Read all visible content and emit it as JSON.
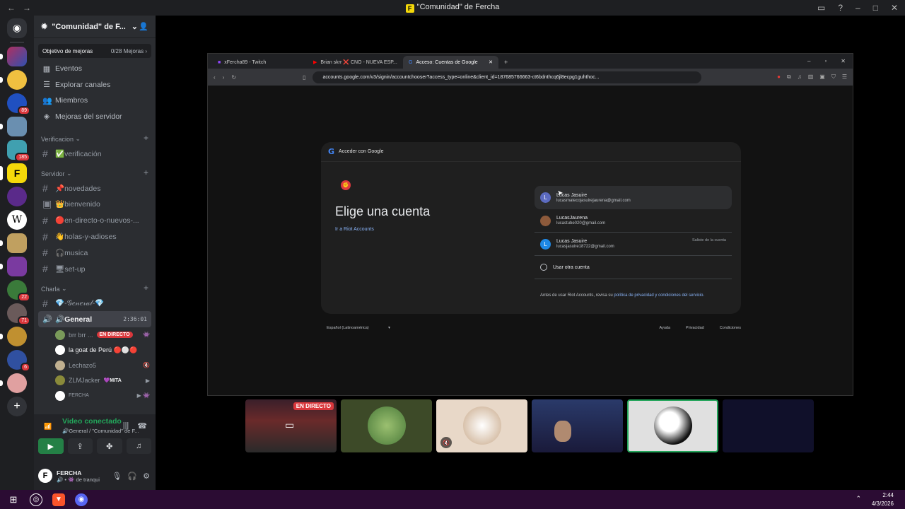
{
  "window": {
    "title": "\"Comunidad\" de Fercha"
  },
  "server": {
    "name": "\"Comunidad\" de F...",
    "boost_label": "Objetivo de mejoras",
    "boost_count": "0/28 Mejoras"
  },
  "guild_badges": {
    "marvel": "89",
    "g5": "185",
    "g13": "22",
    "g14": "71",
    "g16": "6"
  },
  "nav": [
    "Eventos",
    "Explorar canales",
    "Miembros",
    "Mejoras del servidor"
  ],
  "categories": {
    "verificacion": "Verificacion",
    "servidor": "Servidor",
    "charla": "Charla"
  },
  "channels": {
    "verificacion": "✅verificación",
    "servidor": [
      "📌novedades",
      "👑bienvenido",
      "🔴en-directo-o-nuevos-...",
      "👋holas-y-adioses",
      "🎧musica",
      "🖥set-up"
    ],
    "general_text": "💎-𝒢𝑒𝓃𝑒𝓇𝒶𝓁-💎",
    "voice": "🔊General",
    "voice_time": "2:36:01"
  },
  "voice_users": [
    {
      "name": "brr brr ...",
      "live": "EN DIRECTO"
    },
    {
      "name": "la goat de Perú 🔴⚪🔴"
    },
    {
      "name": "Lechazo5"
    },
    {
      "name": "ZLMJacker",
      "tag": "💜MITA"
    },
    {
      "name": "FERCHA"
    }
  ],
  "voice_panel": {
    "status": "Video conectado",
    "location": "🔊General / \"Comunidad\" de F..."
  },
  "user": {
    "name": "FERCHA",
    "status": "🔊 • 👾 de tranqui"
  },
  "browser": {
    "tabs": [
      "xFercha89 - Twitch",
      "Brian skrr ❌ CNO - NUEVA ESP...",
      "Acceso: Cuentas de Google"
    ],
    "url": "accounts.google.com/v3/signin/accountchooser?access_type=online&client_id=187685766663-ct6bdnthcq6jl8ecpg1guhthoc..."
  },
  "google": {
    "header": "Acceder con Google",
    "heading": "Elige una cuenta",
    "link": "Ir a Riot Accounts",
    "accounts": [
      {
        "initial": "L",
        "name": "Lucas Jasuire",
        "email": "lucasmatecojasuirejaurena@gmail.com",
        "color": "#5c6bc0",
        "signed_out": ""
      },
      {
        "initial": "",
        "name": "LucasJaurena",
        "email": "lucastube020@gmail.com",
        "color": "#8d5a3b",
        "signed_out": ""
      },
      {
        "initial": "L",
        "name": "Lucas Jasuire",
        "email": "lucasjasuire18722@gmail.com",
        "color": "#1e88e5",
        "signed_out": "Saliste de la cuenta"
      }
    ],
    "other": "Usar otra cuenta",
    "notice_pre": "Antes de usar Riot Accounts, revisa su ",
    "notice_link": "política de privacidad y condiciones del servicio.",
    "language": "Español (Latinoamérica)",
    "footer": [
      "Ayuda",
      "Privacidad",
      "Condiciones"
    ]
  },
  "tiles": {
    "live_badge": "EN DIRECTO"
  },
  "clock": {
    "time": "2:44",
    "date": "4/3/2026"
  }
}
